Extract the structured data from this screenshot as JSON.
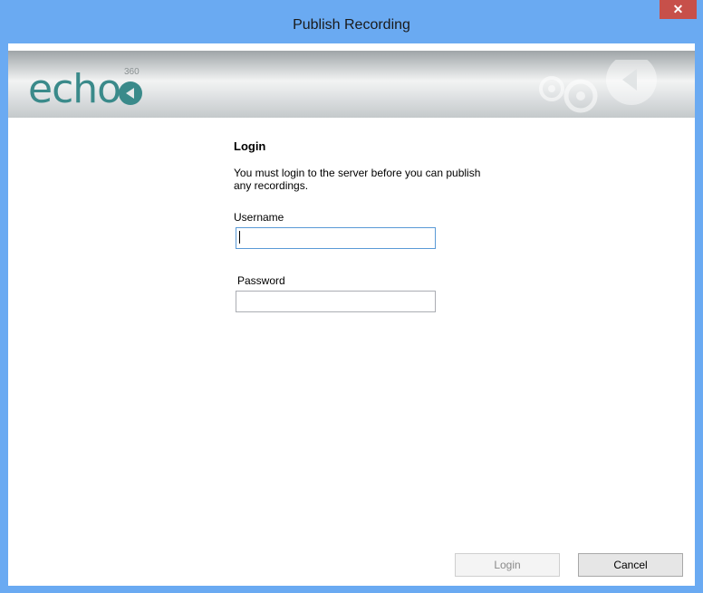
{
  "window": {
    "title": "Publish Recording",
    "close_glyph": "✕"
  },
  "brand": {
    "logo_text": "echo",
    "logo_badge": "360"
  },
  "login": {
    "heading": "Login",
    "description": "You must login to the server before you can publish any recordings.",
    "username_label": "Username",
    "username_value": "",
    "password_label": "Password",
    "password_value": ""
  },
  "buttons": {
    "login_label": "Login",
    "cancel_label": "Cancel"
  },
  "colors": {
    "titlebar": "#6aaaf2",
    "close": "#c7504a",
    "brand": "#3a8a8a"
  }
}
